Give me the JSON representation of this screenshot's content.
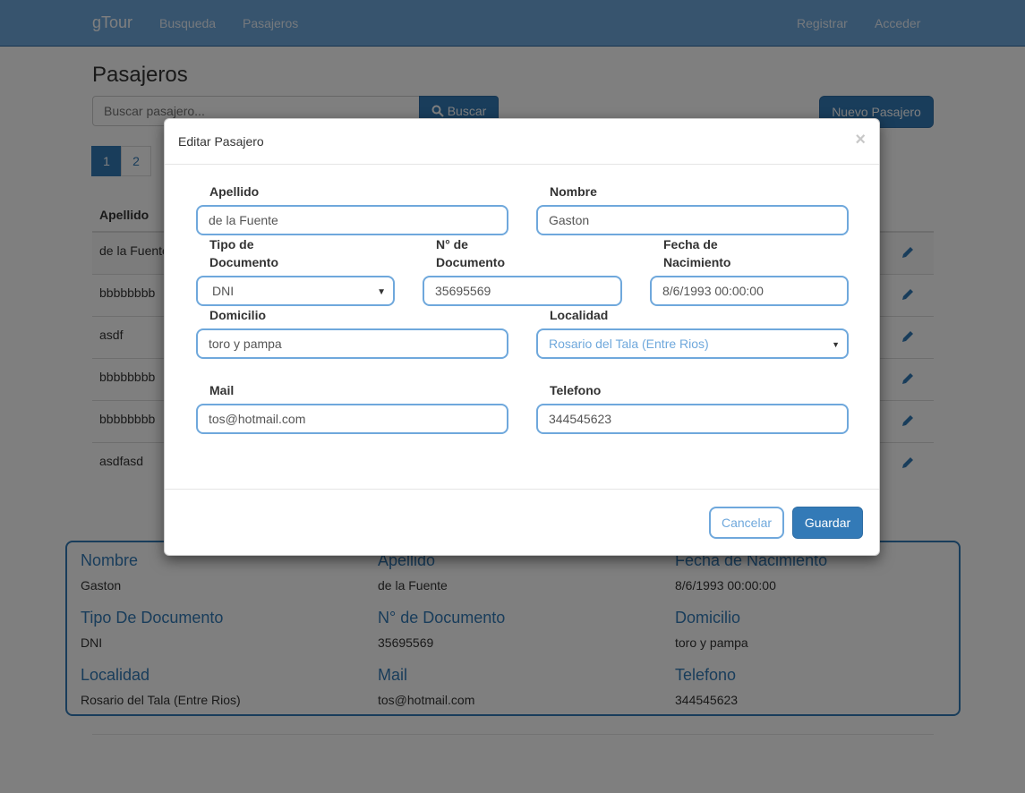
{
  "navbar": {
    "brand": "gTour",
    "links": [
      "Busqueda",
      "Pasajeros"
    ],
    "right_links": [
      "Registrar",
      "Acceder"
    ]
  },
  "page": {
    "title": "Pasajeros",
    "search_placeholder": "Buscar pasajero...",
    "search_button": "Buscar",
    "new_button": "Nuevo Pasajero",
    "pages": [
      "1",
      "2"
    ],
    "active_page": 1
  },
  "table": {
    "header_apellido": "Apellido",
    "rows": [
      "de la Fuente",
      "bbbbbbbb",
      "asdf",
      "bbbbbbbb",
      "bbbbbbbb",
      "asdfasd"
    ]
  },
  "detail": {
    "nombre_label": "Nombre",
    "nombre": "Gaston",
    "apellido_label": "Apellido",
    "apellido": "de la Fuente",
    "fecha_label": "Fecha de Nacimiento",
    "fecha": "8/6/1993 00:00:00",
    "tipo_label": "Tipo De Documento",
    "tipo": "DNI",
    "num_label": "N° de Documento",
    "num": "35695569",
    "domicilio_label": "Domicilio",
    "domicilio": "toro y pampa",
    "localidad_label": "Localidad",
    "localidad": "Rosario del Tala (Entre Rios)",
    "mail_label": "Mail",
    "mail": "tos@hotmail.com",
    "telefono_label": "Telefono",
    "telefono": "344545623"
  },
  "modal": {
    "title": "Editar Pasajero",
    "close": "×",
    "apellido_label": "Apellido",
    "apellido": "de la Fuente",
    "nombre_label": "Nombre",
    "nombre": "Gaston",
    "tipo_label_1": "Tipo de",
    "tipo_label_2": "Documento",
    "tipo": "DNI",
    "num_label_1": "N° de",
    "num_label_2": "Documento",
    "num": "35695569",
    "fecha_label_1": "Fecha de",
    "fecha_label_2": "Nacimiento",
    "fecha": "8/6/1993 00:00:00",
    "domicilio_label": "Domicilio",
    "domicilio": "toro y pampa",
    "localidad_label": "Localidad",
    "localidad": "Rosario del Tala (Entre Rios)",
    "mail_label": "Mail",
    "mail": "tos@hotmail.com",
    "telefono_label": "Telefono",
    "telefono": "344545623",
    "cancel": "Cancelar",
    "save": "Guardar"
  },
  "colors": {
    "primary": "#337ab7",
    "navbar": "#6fa8dc",
    "overlay": "rgba(0,0,0,0.5)"
  }
}
